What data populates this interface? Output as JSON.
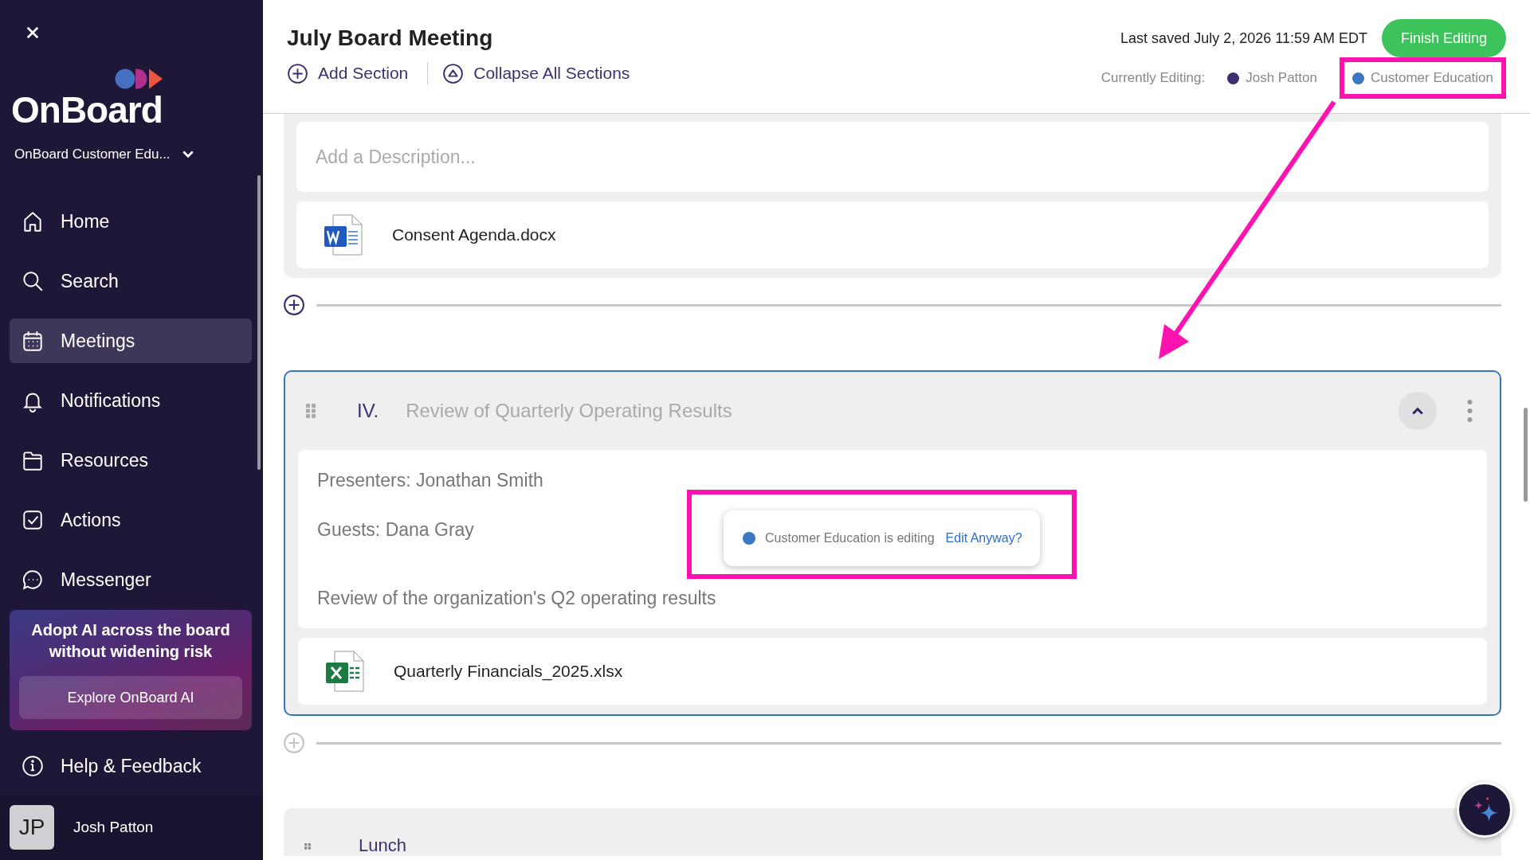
{
  "sidebar": {
    "logo": "OnBoard",
    "org": "OnBoard Customer Edu...",
    "nav": [
      {
        "label": "Home",
        "selected": false
      },
      {
        "label": "Search",
        "selected": false
      },
      {
        "label": "Meetings",
        "selected": true
      },
      {
        "label": "Notifications",
        "selected": false
      },
      {
        "label": "Resources",
        "selected": false
      },
      {
        "label": "Actions",
        "selected": false
      },
      {
        "label": "Messenger",
        "selected": false
      }
    ],
    "promo": {
      "text": "Adopt AI across the board without widening risk",
      "button": "Explore OnBoard AI"
    },
    "help": "Help & Feedback",
    "user": {
      "initials": "JP",
      "name": "Josh Patton"
    }
  },
  "header": {
    "title": "July Board Meeting",
    "actions": [
      "Add Section",
      "Collapse All Sections"
    ],
    "last_saved": "Last saved July 2, 2026 11:59 AM EDT",
    "finish": "Finish Editing",
    "editing_label": "Currently Editing:",
    "editors": [
      {
        "name": "Josh Patton",
        "color": "#3d2f6e",
        "highlighted": false
      },
      {
        "name": "Customer Education",
        "color": "#3a78c4",
        "highlighted": true
      }
    ]
  },
  "sections": [
    {
      "kind": "partial",
      "description_placeholder": "Add a Description...",
      "files": [
        {
          "name": "Consent Agenda.docx",
          "kind": "document"
        }
      ],
      "add_active": true
    },
    {
      "kind": "full",
      "number": "IV.",
      "title": "Review of Quarterly Operating Results",
      "focused": true,
      "locked": true,
      "lines": [
        "Presenters: Jonathan Smith",
        "Guests: Dana Gray",
        "Review of the organization's Q2 operating results"
      ],
      "tooltip": {
        "text": "Customer Education is editing",
        "link": "Edit Anyway?",
        "color": "#3a78c4",
        "highlighted": true
      },
      "files": [
        {
          "name": "Quarterly Financials_2025.xlsx",
          "kind": "spreadsheet"
        }
      ],
      "add_active": false
    },
    {
      "kind": "collapsed",
      "title": "Lunch"
    }
  ]
}
